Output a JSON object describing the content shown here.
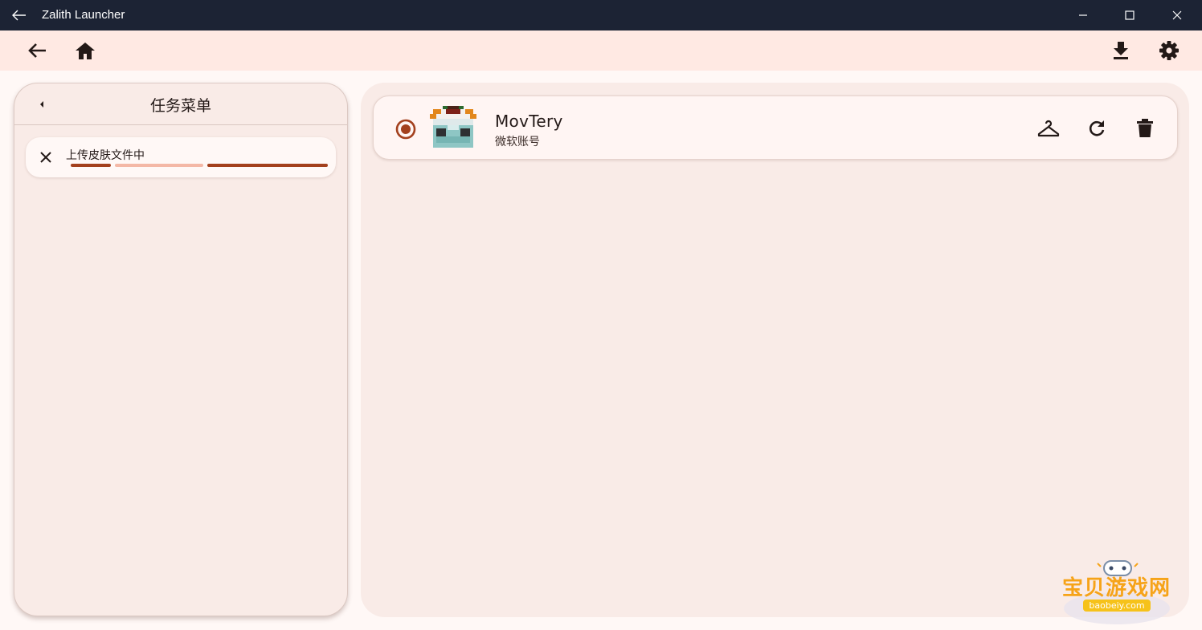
{
  "window": {
    "title": "Zalith Launcher",
    "controls": [
      "minimize-icon",
      "maximize-icon",
      "close-icon"
    ]
  },
  "appbar": {
    "left_icons": [
      "arrow-back-icon",
      "home-icon"
    ],
    "right_icons": [
      "download-icon",
      "settings-gear-icon"
    ]
  },
  "tasks": {
    "title": "任务菜单",
    "items": [
      {
        "label": "上传皮肤文件中",
        "status": "in-progress"
      }
    ]
  },
  "accounts": {
    "items": [
      {
        "name": "MovTery",
        "type": "微软账号",
        "selected": true,
        "actions": [
          "change-skin-hanger-icon",
          "refresh-icon",
          "delete-trash-icon"
        ]
      }
    ]
  },
  "watermark": {
    "text": "宝贝游戏网",
    "url": "baobeiy.com"
  },
  "colors": {
    "titlebar": "#1c2334",
    "appbar": "#ffe9e3",
    "panel": "#f9ebe7",
    "accent": "#a3401d",
    "accent_light": "#f4b8a6"
  }
}
